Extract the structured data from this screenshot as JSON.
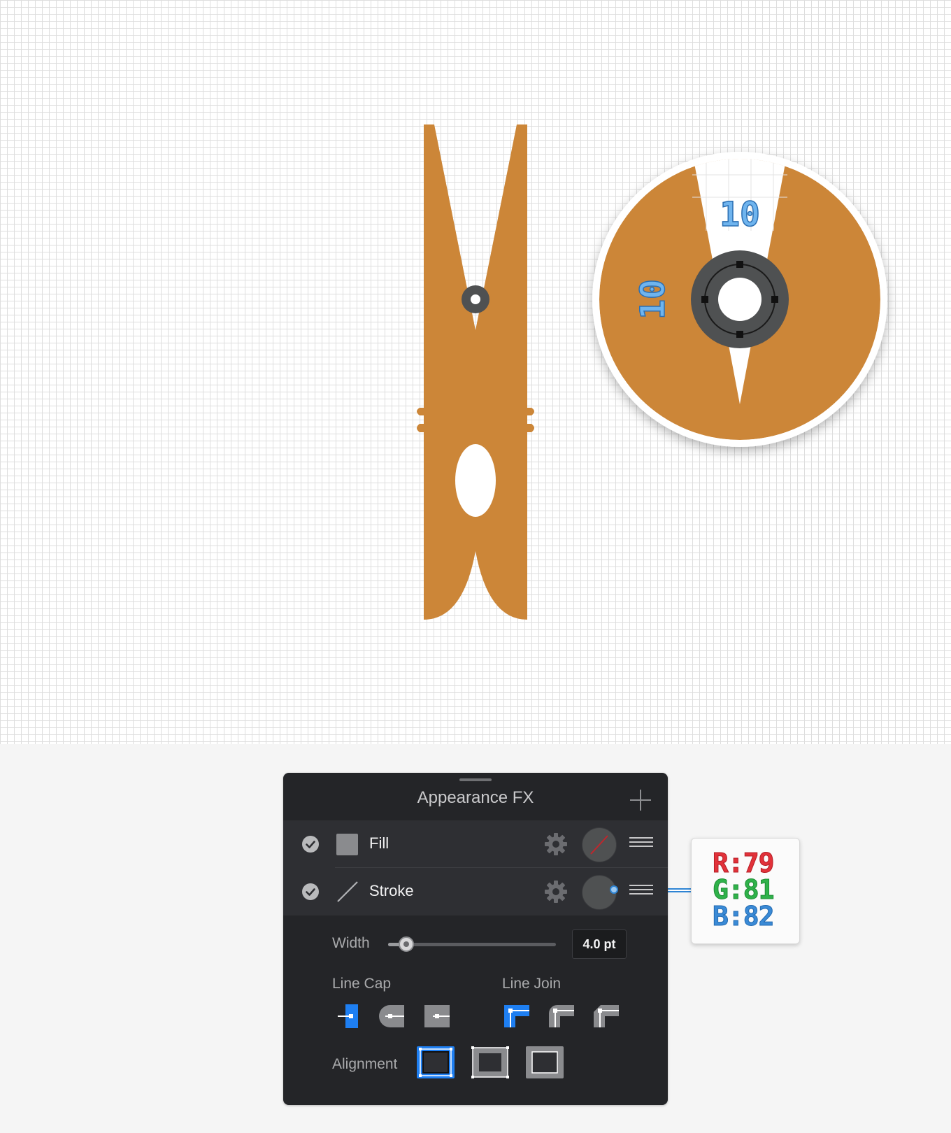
{
  "canvas": {
    "object_color": "#cc8638",
    "grid_color": "#dedede",
    "zoom_callout": {
      "dimension_top": "10",
      "dimension_left": "10",
      "ring_color": "#4f5152"
    }
  },
  "panel": {
    "title": "Appearance FX",
    "add_icon": "plus-icon",
    "rows": [
      {
        "label": "Fill",
        "enabled": true,
        "icon": "fill-swatch-icon"
      },
      {
        "label": "Stroke",
        "enabled": true,
        "icon": "stroke-line-icon"
      }
    ],
    "width_label": "Width",
    "width_value": "4.0 pt",
    "width_slider_fraction": 0.1,
    "line_cap_label": "Line Cap",
    "line_cap_selected": "butt",
    "line_join_label": "Line Join",
    "line_join_selected": "miter",
    "alignment_label": "Alignment",
    "alignment_selected": "center",
    "accent_color": "#1e7ff2"
  },
  "rgb_callout": {
    "r": "R:79",
    "g": "G:81",
    "b": "B:82"
  }
}
